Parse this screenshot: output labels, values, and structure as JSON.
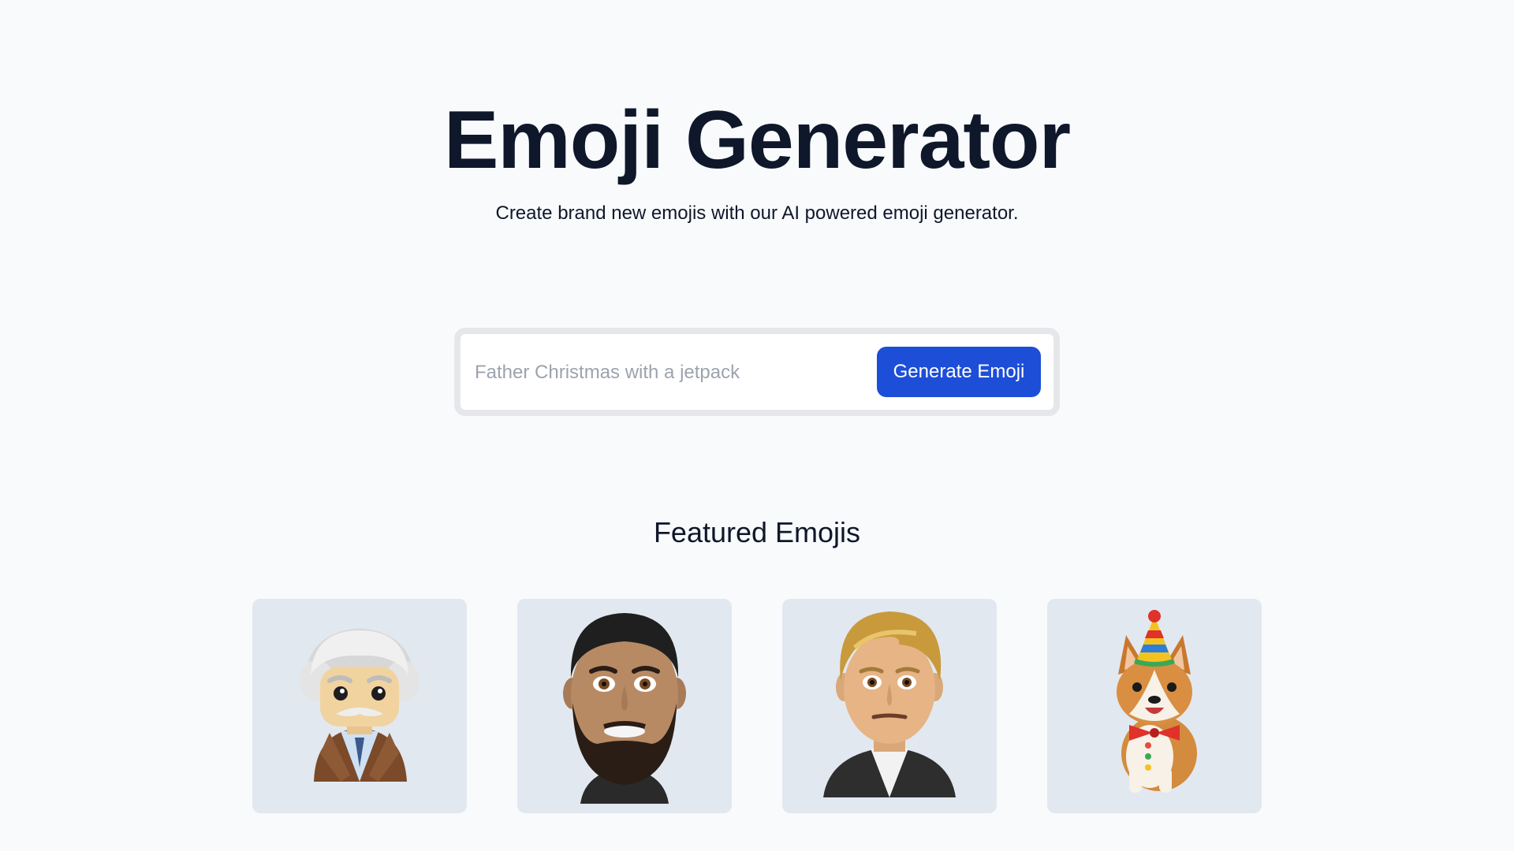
{
  "header": {
    "title": "Emoji Generator",
    "subtitle": "Create brand new emojis with our AI powered emoji generator."
  },
  "prompt_form": {
    "placeholder": "Father Christmas with a jetpack",
    "value": "",
    "button_label": "Generate Emoji"
  },
  "featured": {
    "heading": "Featured Emojis",
    "items": [
      {
        "subject": "einstein-emoji"
      },
      {
        "subject": "bearded-man-emoji"
      },
      {
        "subject": "blond-man-emoji"
      },
      {
        "subject": "party-corgi-emoji"
      }
    ]
  },
  "colors": {
    "background": "#f8fafc",
    "text": "#0f172a",
    "accent": "#1d4ed8",
    "card": "#e2e8f0",
    "input_border": "#e5e7eb",
    "placeholder": "#9ca3af"
  }
}
